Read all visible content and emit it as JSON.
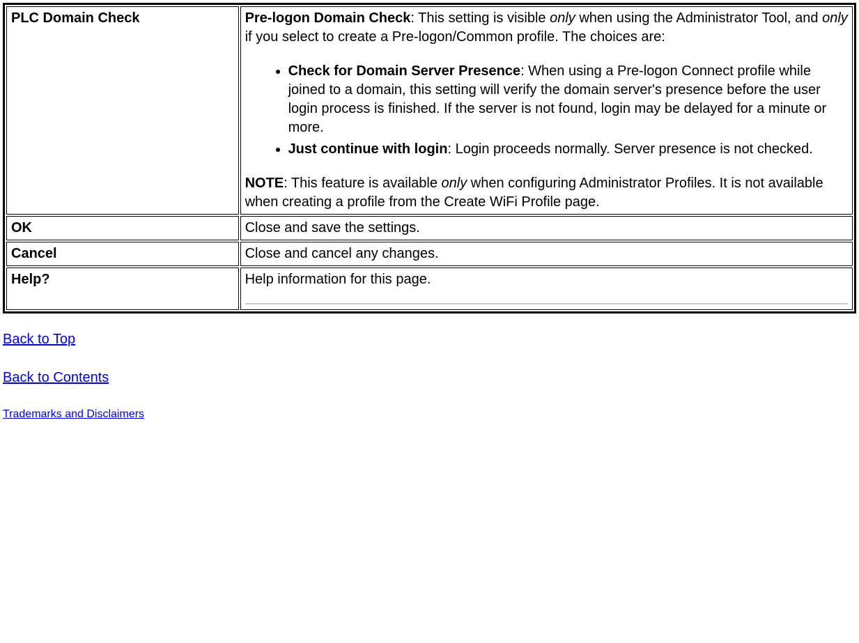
{
  "table": {
    "rows": [
      {
        "label": "PLC Domain Check",
        "intro_bold": "Pre-logon Domain Check",
        "intro_seg1": ": This setting is visible ",
        "intro_only1": "only",
        "intro_seg2": " when using the Administrator Tool, and ",
        "intro_only2": "only",
        "intro_seg3": " if you select to create a Pre-logon/Common profile. The choices are:",
        "bullets": [
          {
            "title": "Check for Domain Server Presence",
            "text": ": When using a Pre-logon Connect profile while joined to a domain, this setting will verify the domain server's presence before the user login process is finished. If the server is not found, login may be delayed for a minute or more."
          },
          {
            "title": "Just continue with login",
            "text": ": Login proceeds normally. Server presence is not checked."
          }
        ],
        "note_bold": "NOTE",
        "note_seg1": ": This feature is available ",
        "note_only": "only",
        "note_seg2": " when configuring Administrator Profiles. It is not available when creating a profile from the Create WiFi Profile page."
      },
      {
        "label": "OK",
        "desc": "Close and save the settings."
      },
      {
        "label": "Cancel",
        "desc": "Close and cancel any changes."
      },
      {
        "label": "Help?",
        "desc": "Help information for this page."
      }
    ]
  },
  "links": {
    "back_top": "Back to Top",
    "back_contents": "Back to Contents",
    "trademarks": "Trademarks and Disclaimers"
  }
}
